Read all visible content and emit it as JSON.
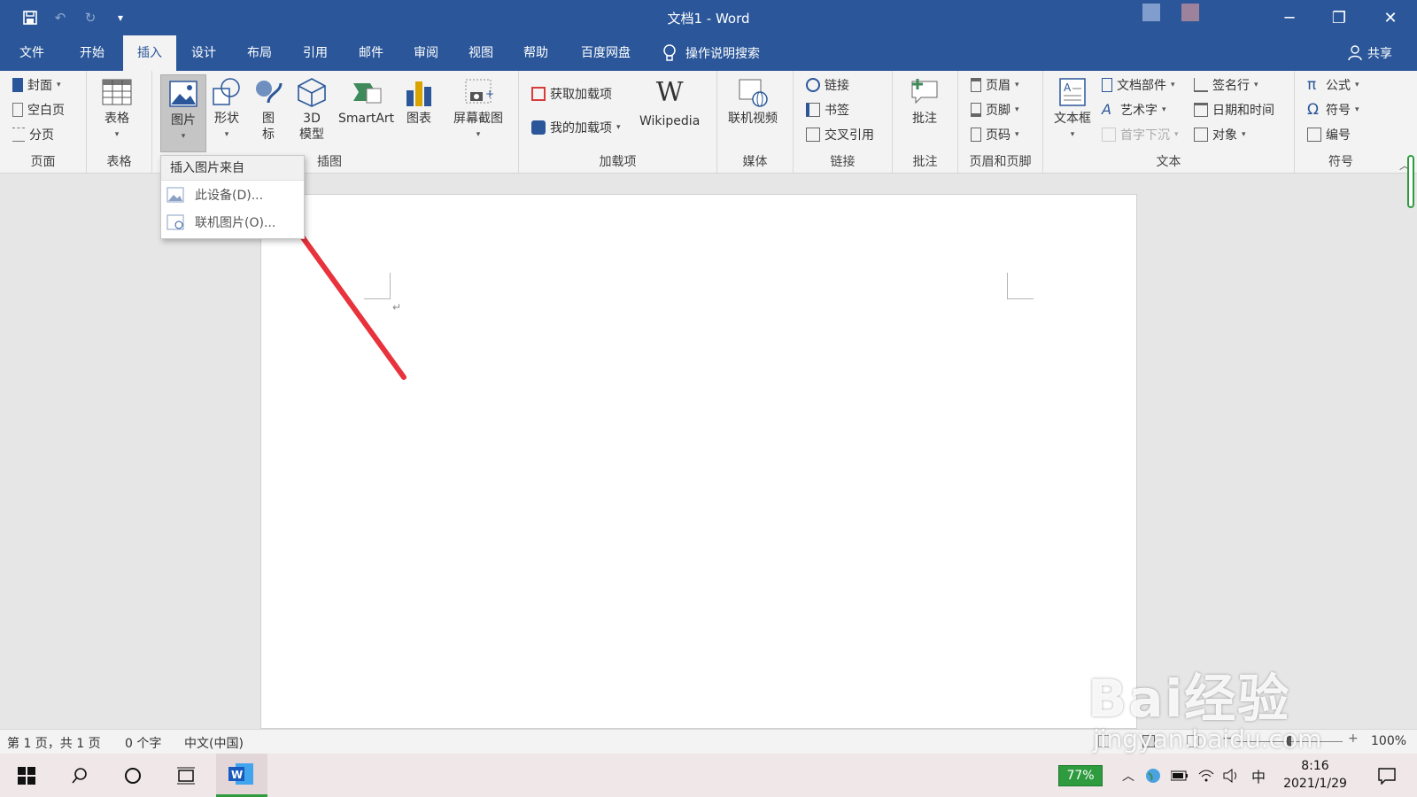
{
  "window": {
    "title": "文档1 - Word",
    "minimize_glyph": "─",
    "restore_glyph": "❐",
    "close_glyph": "✕"
  },
  "qat": {
    "undo_label": "↶",
    "redo_label": "↻",
    "customize_label": "▾"
  },
  "tabs": {
    "file": "文件",
    "home": "开始",
    "insert": "插入",
    "design": "设计",
    "layout": "布局",
    "references": "引用",
    "mailings": "邮件",
    "review": "审阅",
    "view": "视图",
    "help": "帮助",
    "baidu": "百度网盘",
    "tellme": "操作说明搜索",
    "share": "共享"
  },
  "ribbon": {
    "pages": {
      "cover": "封面",
      "blank": "空白页",
      "break": "分页",
      "label": "页面"
    },
    "table": {
      "table": "表格",
      "label": "表格"
    },
    "illustrations": {
      "pictures": "图片",
      "shapes": "形状",
      "icons": "图标",
      "model3d": "3D模型",
      "smartart": "SmartArt",
      "chart": "图表",
      "screenshot": "屏幕截图",
      "label": "插图"
    },
    "addins": {
      "get": "获取加载项",
      "my": "我的加载项",
      "wikipedia": "Wikipedia",
      "label": "加载项"
    },
    "media": {
      "video": "联机视频",
      "label": "媒体"
    },
    "links": {
      "link": "链接",
      "bookmark": "书签",
      "crossref": "交叉引用",
      "label": "链接"
    },
    "comments": {
      "comment": "批注",
      "label": "批注"
    },
    "header_footer": {
      "header": "页眉",
      "footer": "页脚",
      "page_number": "页码",
      "label": "页眉和页脚"
    },
    "text": {
      "textbox": "文本框",
      "quickparts": "文档部件",
      "wordart": "艺术字",
      "dropcap": "首字下沉",
      "signature": "签名行",
      "datetime": "日期和时间",
      "object": "对象",
      "label": "文本"
    },
    "symbols": {
      "equation": "公式",
      "symbol": "符号",
      "number": "编号",
      "label": "符号"
    }
  },
  "dropdown": {
    "header": "插入图片来自",
    "items": [
      "此设备(D)...",
      "联机图片(O)..."
    ]
  },
  "document": {
    "paragraph_mark": "↵"
  },
  "statusbar": {
    "page": "第 1 页，共 1 页",
    "words": "0 个字",
    "language": "中文(中国)",
    "zoom": "100%"
  },
  "taskbar": {
    "battery": "77%",
    "ime": "中",
    "time": "8:16",
    "date": "2021/1/29"
  },
  "watermark": {
    "brand": "Bai经验",
    "url": "jingyan.baidu.com"
  },
  "colors": {
    "accent": "#2b579a",
    "annotation_arrow": "#e8323c",
    "battery": "#2e9b3f"
  }
}
